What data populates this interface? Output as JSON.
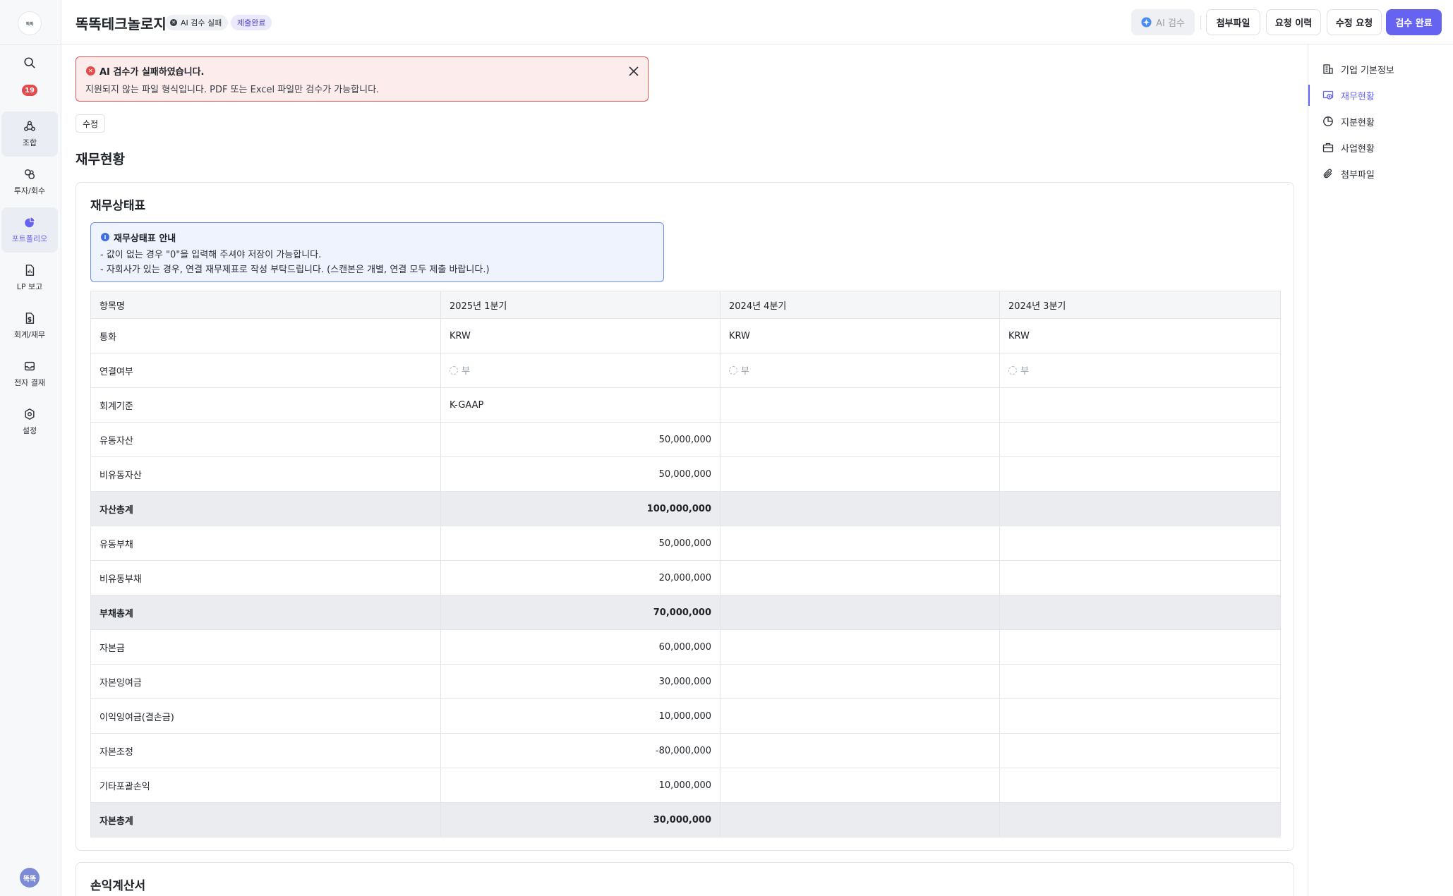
{
  "rail": {
    "logo_text": "똑똑",
    "notification_count": "19",
    "items": [
      {
        "label": "조합",
        "icon": "group-icon"
      },
      {
        "label": "투자/회수",
        "icon": "invest-icon"
      },
      {
        "label": "포트폴리오",
        "icon": "portfolio-icon"
      },
      {
        "label": "LP 보고",
        "icon": "report-icon"
      },
      {
        "label": "회계/재무",
        "icon": "accounting-icon"
      },
      {
        "label": "전자 결재",
        "icon": "approval-icon"
      },
      {
        "label": "설정",
        "icon": "settings-icon"
      }
    ],
    "avatar": "똑똑"
  },
  "header": {
    "company": "똑똑테크놀로지",
    "status_fail": "AI 검수 실패",
    "status_done": "제출완료",
    "buttons": {
      "ai_review": "AI 검수",
      "attachments": "첨부파일",
      "request_history": "요청 이력",
      "edit_request": "수정 요청",
      "review_complete": "검수 완료"
    }
  },
  "alert": {
    "title": "AI 검수가 실패하였습니다.",
    "message": "지원되지 않는 파일 형식입니다. PDF 또는 Excel 파일만 검수가 가능합니다."
  },
  "edit_label": "수정",
  "page_title": "재무현황",
  "balance_sheet": {
    "title": "재무상태표",
    "info_title": "재무상태표 안내",
    "info_lines": [
      "- 값이 없는 경우 \"0\"을 입력해 주셔야 저장이 가능합니다.",
      "- 자회사가 있는 경우, 연결 재무제표로 작성 부탁드립니다. (스캔본은 개별, 연결 모두 제출 바랍니다.)"
    ],
    "columns": [
      "항목명",
      "2025년 1분기",
      "2024년 4분기",
      "2024년 3분기"
    ],
    "rows": [
      {
        "name": "통화",
        "q1": "KRW",
        "q2": "KRW",
        "q3": "KRW",
        "total": false
      },
      {
        "name": "연결여부",
        "q1": "부",
        "q2": "부",
        "q3": "부",
        "total": false,
        "radio": true
      },
      {
        "name": "회계기준",
        "q1": "K-GAAP",
        "q2": "",
        "q3": "",
        "total": false
      },
      {
        "name": "유동자산",
        "q1": "50,000,000",
        "q2": "",
        "q3": "",
        "total": false,
        "num": true
      },
      {
        "name": "비유동자산",
        "q1": "50,000,000",
        "q2": "",
        "q3": "",
        "total": false,
        "num": true
      },
      {
        "name": "자산총계",
        "q1": "100,000,000",
        "q2": "",
        "q3": "",
        "total": true,
        "num": true
      },
      {
        "name": "유동부채",
        "q1": "50,000,000",
        "q2": "",
        "q3": "",
        "total": false,
        "num": true
      },
      {
        "name": "비유동부채",
        "q1": "20,000,000",
        "q2": "",
        "q3": "",
        "total": false,
        "num": true
      },
      {
        "name": "부채총계",
        "q1": "70,000,000",
        "q2": "",
        "q3": "",
        "total": true,
        "num": true
      },
      {
        "name": "자본금",
        "q1": "60,000,000",
        "q2": "",
        "q3": "",
        "total": false,
        "num": true
      },
      {
        "name": "자본잉여금",
        "q1": "30,000,000",
        "q2": "",
        "q3": "",
        "total": false,
        "num": true
      },
      {
        "name": "이익잉여금(결손금)",
        "q1": "10,000,000",
        "q2": "",
        "q3": "",
        "total": false,
        "num": true
      },
      {
        "name": "자본조정",
        "q1": "-80,000,000",
        "q2": "",
        "q3": "",
        "total": false,
        "num": true
      },
      {
        "name": "기타포괄손익",
        "q1": "10,000,000",
        "q2": "",
        "q3": "",
        "total": false,
        "num": true
      },
      {
        "name": "자본총계",
        "q1": "30,000,000",
        "q2": "",
        "q3": "",
        "total": true,
        "num": true
      }
    ]
  },
  "income_statement": {
    "title": "손익계산서"
  },
  "right_nav": [
    {
      "label": "기업 기본정보",
      "icon": "building-icon",
      "active": false
    },
    {
      "label": "재무현황",
      "icon": "finance-icon",
      "active": true
    },
    {
      "label": "지분현황",
      "icon": "pie-icon",
      "active": false
    },
    {
      "label": "사업현황",
      "icon": "briefcase-icon",
      "active": false
    },
    {
      "label": "첨부파일",
      "icon": "paperclip-icon",
      "active": false
    }
  ],
  "colors": {
    "accent": "#6663f0",
    "error": "#e24b4b",
    "info_border": "#6a8ef0"
  }
}
